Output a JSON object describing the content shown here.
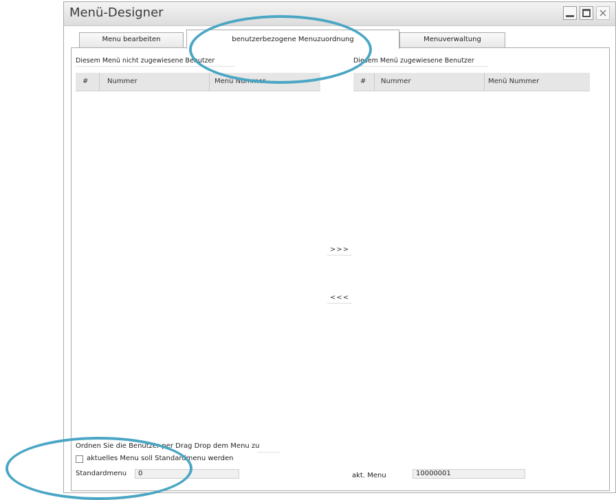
{
  "window": {
    "title": "Menü-Designer",
    "close_glyph": "×"
  },
  "tabs": [
    {
      "label": "Menu bearbeiten"
    },
    {
      "label": "benutzerbezogene Menuzuordnung"
    },
    {
      "label": "Menuverwaltung"
    }
  ],
  "left_grid": {
    "title": "Diesem Menü nicht zugewiesene Benutzer",
    "columns": [
      "#",
      "Nummer",
      "Menü Nummer"
    ]
  },
  "right_grid": {
    "title": "Diesem Menü zugewiesene Benutzer",
    "columns": [
      "#",
      "Nummer",
      "Menü Nummer"
    ]
  },
  "buttons": {
    "assign": ">>>",
    "unassign": "<<<"
  },
  "footer": {
    "hint": "Ordnen Sie die Benutzer per Drag  Drop dem Menu zu",
    "checkbox_label": "aktuelles Menu soll Standardmenu werden",
    "standard_label": "Standardmenu",
    "standard_value": "0",
    "current_label": "akt. Menu",
    "current_value": "10000001"
  },
  "colors": {
    "highlight_circle": "#4aa6c4"
  }
}
